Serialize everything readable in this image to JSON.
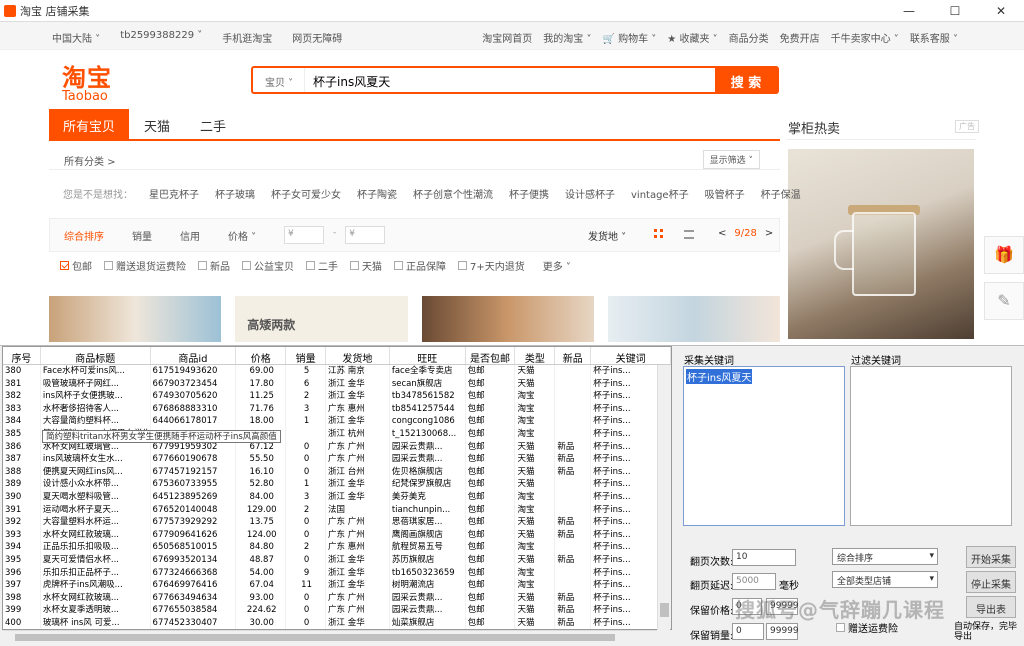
{
  "window": {
    "title": "淘宝 店铺采集",
    "controls": [
      "—",
      "☐",
      "✕"
    ]
  },
  "topnav": {
    "left": [
      "中国大陆 ˅",
      "tb2599388229 ˅",
      "手机逛淘宝",
      "网页无障碍"
    ],
    "right": [
      "淘宝网首页",
      "我的淘宝 ˅",
      "🛒 购物车 ˅",
      "★ 收藏夹 ˅",
      "商品分类",
      "免费开店",
      "千牛卖家中心 ˅",
      "联系客服 ˅"
    ]
  },
  "logo": {
    "cn": "淘宝",
    "en": "Taobao"
  },
  "search": {
    "category": "宝贝 ˅",
    "query": "杯子ins风夏天",
    "button": "搜 索"
  },
  "tabs": [
    "所有宝贝",
    "天猫",
    "二手"
  ],
  "sidebar": {
    "title": "掌柜热卖",
    "ad_tag": "广告"
  },
  "category_row": {
    "label": "所有分类 >",
    "filter": "显示筛选 ˅"
  },
  "suggestions": {
    "label": "您是不是想找：",
    "items": [
      "星巴克杯子",
      "杯子玻璃",
      "杯子女可爱少女",
      "杯子陶瓷",
      "杯子创意个性潮流",
      "杯子便携",
      "设计感杯子",
      "vintage杯子",
      "吸管杯子",
      "杯子保温"
    ]
  },
  "sortbar": {
    "items": [
      "综合排序",
      "销量",
      "信用",
      "价格 ˅"
    ],
    "price_min": "¥",
    "price_max": "¥",
    "ship": "发货地 ˅",
    "prev": "<",
    "page": "9/28",
    "next": ">"
  },
  "filters": [
    {
      "label": "包邮",
      "checked": true
    },
    {
      "label": "赠送退货运费险",
      "checked": false
    },
    {
      "label": "新品",
      "checked": false
    },
    {
      "label": "公益宝贝",
      "checked": false
    },
    {
      "label": "二手",
      "checked": false
    },
    {
      "label": "天猫",
      "checked": false
    },
    {
      "label": "正品保障",
      "checked": false
    },
    {
      "label": "7+天内退货",
      "checked": false
    },
    {
      "label": "更多 ˅",
      "checked": null
    }
  ],
  "product_banner_text": "高矮两款",
  "table": {
    "headers": [
      "序号",
      "商品标题",
      "商品id",
      "价格",
      "销量",
      "发货地",
      "旺旺",
      "是否包邮",
      "类型",
      "新品",
      "关键词"
    ],
    "rows": [
      [
        "380",
        "Face水杯可爱ins风...",
        "617519493620",
        "69.00",
        "5",
        "江苏 南京",
        "face全季专卖店",
        "包邮",
        "天猫",
        "",
        "杯子ins..."
      ],
      [
        "381",
        "吸管玻璃杯子网红...",
        "667903723454",
        "17.80",
        "6",
        "浙江 金华",
        "secan旗舰店",
        "包邮",
        "天猫",
        "",
        "杯子ins..."
      ],
      [
        "382",
        "ins风杯子女便携玻...",
        "674930705620",
        "11.25",
        "2",
        "浙江 金华",
        "tb3478561582",
        "包邮",
        "淘宝",
        "",
        "杯子ins..."
      ],
      [
        "383",
        "水杯奢侈招待客人...",
        "676868883310",
        "71.76",
        "3",
        "广东 惠州",
        "tb8541257544",
        "包邮",
        "淘宝",
        "",
        "杯子ins..."
      ],
      [
        "384",
        "大容量简约塑料杯...",
        "644066178017",
        "18.00",
        "1",
        "浙江 金华",
        "congcong1086",
        "包邮",
        "淘宝",
        "",
        "杯子ins..."
      ],
      [
        "385",
        "简约塑料tritan水杯男女学生便携随手杯运动杯子ins风高颜值",
        "",
        "",
        "",
        "浙江 杭州",
        "t_152130068...",
        "包邮",
        "淘宝",
        "",
        "杯子ins..."
      ],
      [
        "386",
        "水杯女网红玻璃管...",
        "677991959302",
        "67.12",
        "0",
        "广东 广州",
        "园采云贵鼎...",
        "包邮",
        "天猫",
        "新品",
        "杯子ins..."
      ],
      [
        "387",
        "ins风玻璃杯女生水...",
        "677660190678",
        "55.50",
        "0",
        "广东 广州",
        "园采云贵鼎...",
        "包邮",
        "天猫",
        "新品",
        "杯子ins..."
      ],
      [
        "388",
        "便携夏天网红ins风...",
        "677457192157",
        "16.10",
        "0",
        "浙江 台州",
        "佐贝格旗舰店",
        "包邮",
        "天猫",
        "新品",
        "杯子ins..."
      ],
      [
        "389",
        "设计感小众水杯带...",
        "675360733955",
        "52.80",
        "1",
        "浙江 金华",
        "纪梵保罗旗舰店",
        "包邮",
        "天猫",
        "",
        "杯子ins..."
      ],
      [
        "390",
        "夏天喝水塑料吸管...",
        "645123895269",
        "84.00",
        "3",
        "浙江 金华",
        "美芬美克",
        "包邮",
        "淘宝",
        "",
        "杯子ins..."
      ],
      [
        "391",
        "运动喝水杯子夏天...",
        "676520140048",
        "129.00",
        "2",
        "法国",
        "tianchunpin...",
        "包邮",
        "淘宝",
        "",
        "杯子ins..."
      ],
      [
        "392",
        "大容量塑料水杯运...",
        "677573929292",
        "13.75",
        "0",
        "广东 广州",
        "思蓓琪家居...",
        "包邮",
        "天猫",
        "新品",
        "杯子ins..."
      ],
      [
        "393",
        "水杯女网红款玻璃...",
        "677909641626",
        "124.00",
        "0",
        "广东 广州",
        "鹰阁画旗舰店",
        "包邮",
        "天猫",
        "新品",
        "杯子ins..."
      ],
      [
        "394",
        "正品乐扣乐扣吸吸...",
        "650568510015",
        "84.80",
        "2",
        "广东 惠州",
        "航程贸易五号",
        "包邮",
        "淘宝",
        "",
        "杯子ins..."
      ],
      [
        "395",
        "夏天可爱情侣水杯...",
        "676993520134",
        "48.87",
        "0",
        "浙江 金华",
        "苏历旗舰店",
        "包邮",
        "天猫",
        "新品",
        "杯子ins..."
      ],
      [
        "396",
        "乐扣乐扣正品杯子...",
        "677324666368",
        "54.00",
        "9",
        "浙江 金华",
        "tb1650323659",
        "包邮",
        "淘宝",
        "",
        "杯子ins..."
      ],
      [
        "397",
        "虎牌杯子ins风潮吸...",
        "676469976416",
        "67.04",
        "11",
        "浙江 金华",
        "树明潮流店",
        "包邮",
        "淘宝",
        "",
        "杯子ins..."
      ],
      [
        "398",
        "水杯女网红款玻璃...",
        "677663494634",
        "93.00",
        "0",
        "广东 广州",
        "园采云贵鼎...",
        "包邮",
        "天猫",
        "新品",
        "杯子ins..."
      ],
      [
        "399",
        "水杯女夏季透明玻...",
        "677655038584",
        "224.62",
        "0",
        "广东 广州",
        "园采云贵鼎...",
        "包邮",
        "天猫",
        "新品",
        "杯子ins..."
      ],
      [
        "400",
        "玻璃杯 ins风 可爱...",
        "677452330407",
        "30.00",
        "0",
        "浙江 金华",
        "灿菜旗舰店",
        "包邮",
        "天猫",
        "新品",
        "杯子ins..."
      ]
    ]
  },
  "collect": {
    "keywords_label": "采集关键词",
    "keywords_value": "杯子ins风夏天",
    "filter_label": "过滤关键词",
    "pages_label": "翻页次数:",
    "pages_value": "10",
    "delay_label": "翻页延迟:",
    "delay_value": "5000",
    "delay_unit": "毫秒",
    "price_label": "保留价格:",
    "price_min": "0",
    "price_max": "99999",
    "sales_label": "保留销量:",
    "sales_min": "0",
    "sales_max": "99999",
    "sort_select": "综合排序",
    "type_select": "全部类型店铺",
    "start_btn": "开始采集",
    "stop_btn": "停止采集",
    "export_btn": "导出表",
    "freeship_label": "赠送运费险",
    "autosave_label": "自动保存，完毕导出"
  },
  "watermark": "搜狐号@气辞蹦几课程"
}
